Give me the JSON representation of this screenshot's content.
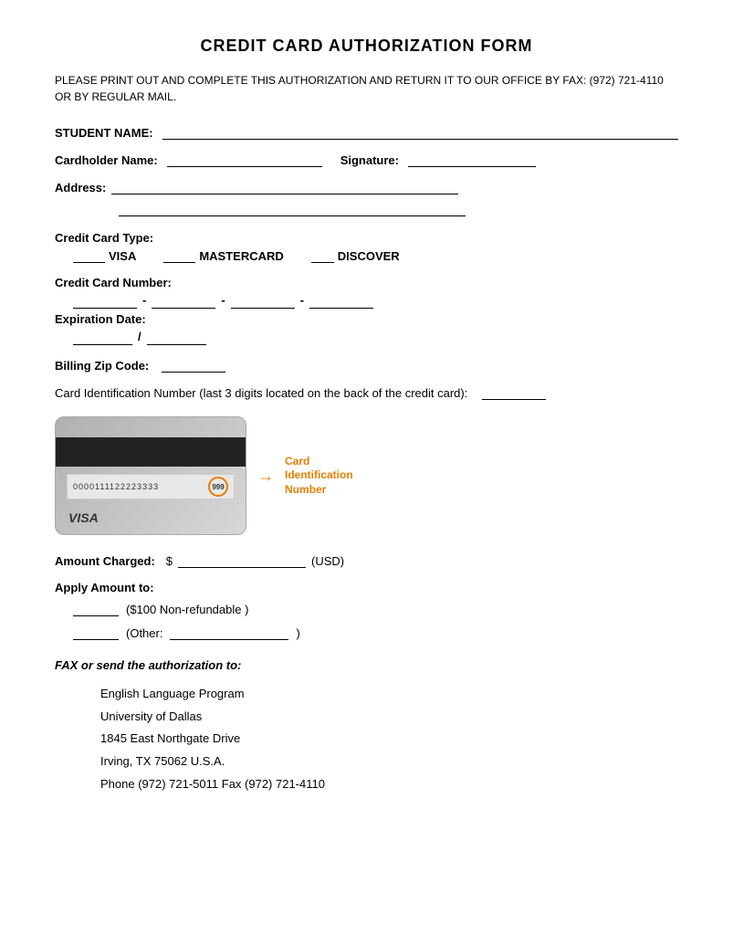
{
  "form": {
    "title": "CREDIT CARD AUTHORIZATION FORM",
    "instructions": "PLEASE PRINT OUT AND COMPLETE THIS AUTHORIZATION AND RETURN IT TO OUR OFFICE BY FAX: (972) 721-4110 OR BY REGULAR MAIL.",
    "student_name_label": "STUDENT NAME:",
    "cardholder_name_label": "Cardholder Name:",
    "signature_label": "Signature:",
    "address_label": "Address:",
    "cc_type_label": "Credit Card Type:",
    "cc_options": [
      "VISA",
      "MASTERCARD",
      "DISCOVER"
    ],
    "cc_number_label": "Credit Card Number:",
    "expiry_label": "Expiration Date:",
    "billing_zip_label": "Billing Zip Code:",
    "cvv_label": "Card Identification Number (last 3 digits located on the back of the credit card):",
    "card_number_display": "0000111122223333",
    "card_cvv_display": "999",
    "card_brand": "VISA",
    "card_id_label": "Card Identification Number",
    "amount_label": "Amount Charged:",
    "amount_currency": "$",
    "amount_suffix": "(USD)",
    "apply_label": "Apply Amount to:",
    "apply_option1": "($100 Non-refundable )",
    "apply_option2_prefix": "(Other:",
    "apply_option2_suffix": ")",
    "fax_title": "FAX or send the authorization to:",
    "address_line1": "English Language Program",
    "address_line2": "University of Dallas",
    "address_line3": "1845 East Northgate Drive",
    "address_line4": "Irving, TX 75062     U.S.A.",
    "address_line5": "Phone (972) 721-5011   Fax (972) 721-4110"
  }
}
